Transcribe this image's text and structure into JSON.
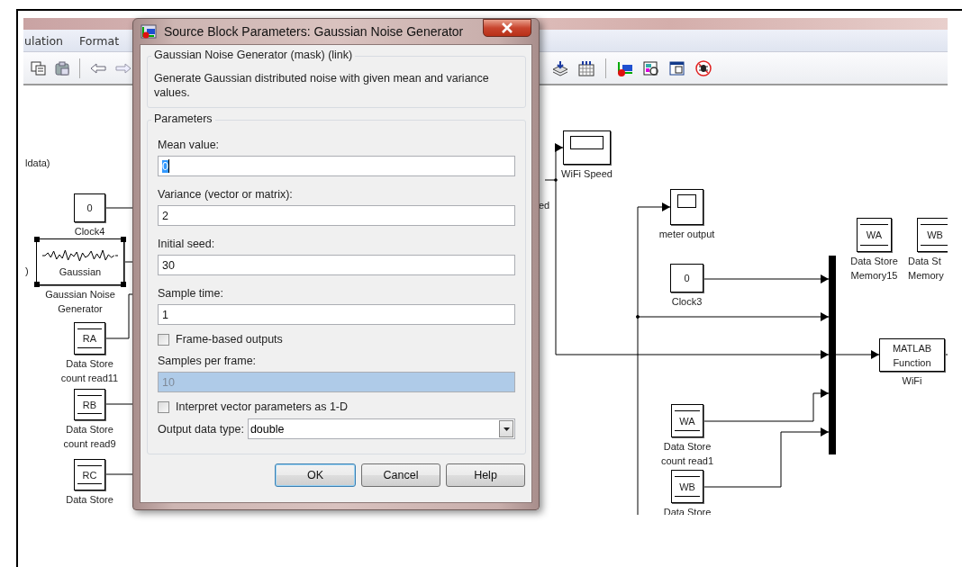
{
  "model_window": {
    "menu": [
      {
        "label": "ulation"
      },
      {
        "label": "Format"
      }
    ],
    "blocks": [
      {
        "kind": "fragment",
        "text": "ldata)"
      },
      {
        "kind": "fragment",
        "text": ")"
      },
      {
        "kind": "constant",
        "text": "0",
        "label_lines": [
          "Clock4"
        ]
      },
      {
        "kind": "gaussian",
        "text": "Gaussian",
        "label_lines": [
          "Gaussian Noise",
          "Generator"
        ],
        "selected": true
      },
      {
        "kind": "data_store",
        "text": "RA",
        "label_lines": [
          "Data Store",
          "count read11"
        ]
      },
      {
        "kind": "data_store",
        "text": "RB",
        "label_lines": [
          "Data Store",
          "count read9"
        ]
      },
      {
        "kind": "data_store",
        "text": "RC",
        "label_lines": [
          "Data Store"
        ]
      },
      {
        "kind": "fragment",
        "text": "ed"
      },
      {
        "kind": "scope",
        "label_lines": [
          "WiFi Speed"
        ]
      },
      {
        "kind": "scope",
        "label_lines": [
          "meter output"
        ]
      },
      {
        "kind": "data_store",
        "text": "WA",
        "label_lines": [
          "Data Store",
          "Memory15"
        ]
      },
      {
        "kind": "data_store",
        "text": "WB",
        "label_lines": [
          "Data St",
          "Memory"
        ]
      },
      {
        "kind": "constant",
        "text": "0",
        "label_lines": [
          "Clock3"
        ]
      },
      {
        "kind": "mux"
      },
      {
        "kind": "function",
        "text": "MATLAB Function",
        "label_lines": [
          "WiFi"
        ]
      },
      {
        "kind": "data_store",
        "text": "WA",
        "label_lines": [
          "Data Store",
          "count read1"
        ]
      },
      {
        "kind": "data_store",
        "text": "WB",
        "label_lines": [
          "Data Store"
        ]
      }
    ]
  },
  "dialog": {
    "title": "Source Block Parameters: Gaussian Noise Generator",
    "description": {
      "title": "Gaussian Noise Generator (mask) (link)",
      "text": "Generate Gaussian distributed noise with given mean and variance values."
    },
    "parameters": {
      "title": "Parameters",
      "items": [
        {
          "kind": "field",
          "label": "Mean value:",
          "value": "0",
          "focused": true,
          "disabled": false
        },
        {
          "kind": "field",
          "label": "Variance (vector or matrix):",
          "value": "2",
          "focused": false,
          "disabled": false
        },
        {
          "kind": "field",
          "label": "Initial seed:",
          "value": "30",
          "focused": false,
          "disabled": false
        },
        {
          "kind": "field",
          "label": "Sample time:",
          "value": "1",
          "focused": false,
          "disabled": false
        },
        {
          "kind": "checkbox",
          "label": "Frame-based outputs",
          "checked": false
        },
        {
          "kind": "field",
          "label": "Samples per frame:",
          "value": "10",
          "focused": false,
          "disabled": true
        },
        {
          "kind": "checkbox",
          "label": "Interpret vector parameters as 1-D",
          "checked": false
        },
        {
          "kind": "dropdown",
          "label": "Output data type:",
          "value": "double"
        }
      ]
    },
    "buttons": [
      {
        "label": "OK",
        "default": true
      },
      {
        "label": "Cancel",
        "default": false
      },
      {
        "label": "Help",
        "default": false
      }
    ]
  }
}
